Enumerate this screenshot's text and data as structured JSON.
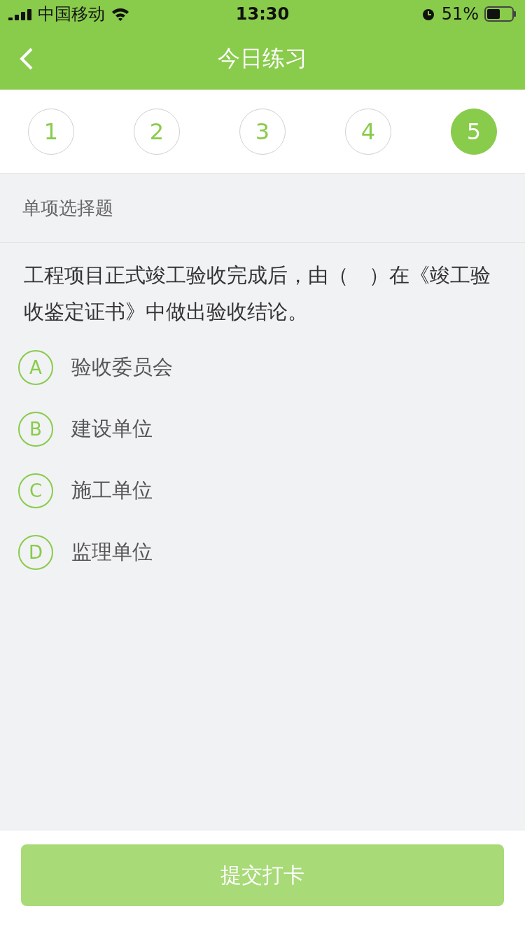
{
  "status_bar": {
    "carrier": "中国移动",
    "time": "13:30",
    "battery": "51%"
  },
  "nav": {
    "title": "今日练习"
  },
  "question_tabs": [
    {
      "label": "1",
      "selected": false
    },
    {
      "label": "2",
      "selected": false
    },
    {
      "label": "3",
      "selected": false
    },
    {
      "label": "4",
      "selected": false
    },
    {
      "label": "5",
      "selected": true
    }
  ],
  "section_title": "单项选择题",
  "question": "工程项目正式竣工验收完成后，由（　）在《竣工验收鉴定证书》中做出验收结论。",
  "options": [
    {
      "letter": "A",
      "text": "验收委员会",
      "selected": false
    },
    {
      "letter": "B",
      "text": "建设单位",
      "selected": false
    },
    {
      "letter": "C",
      "text": "施工单位",
      "selected": false
    },
    {
      "letter": "D",
      "text": "监理单位",
      "selected": false
    }
  ],
  "submit": {
    "label": "提交打卡",
    "disabled": true
  }
}
